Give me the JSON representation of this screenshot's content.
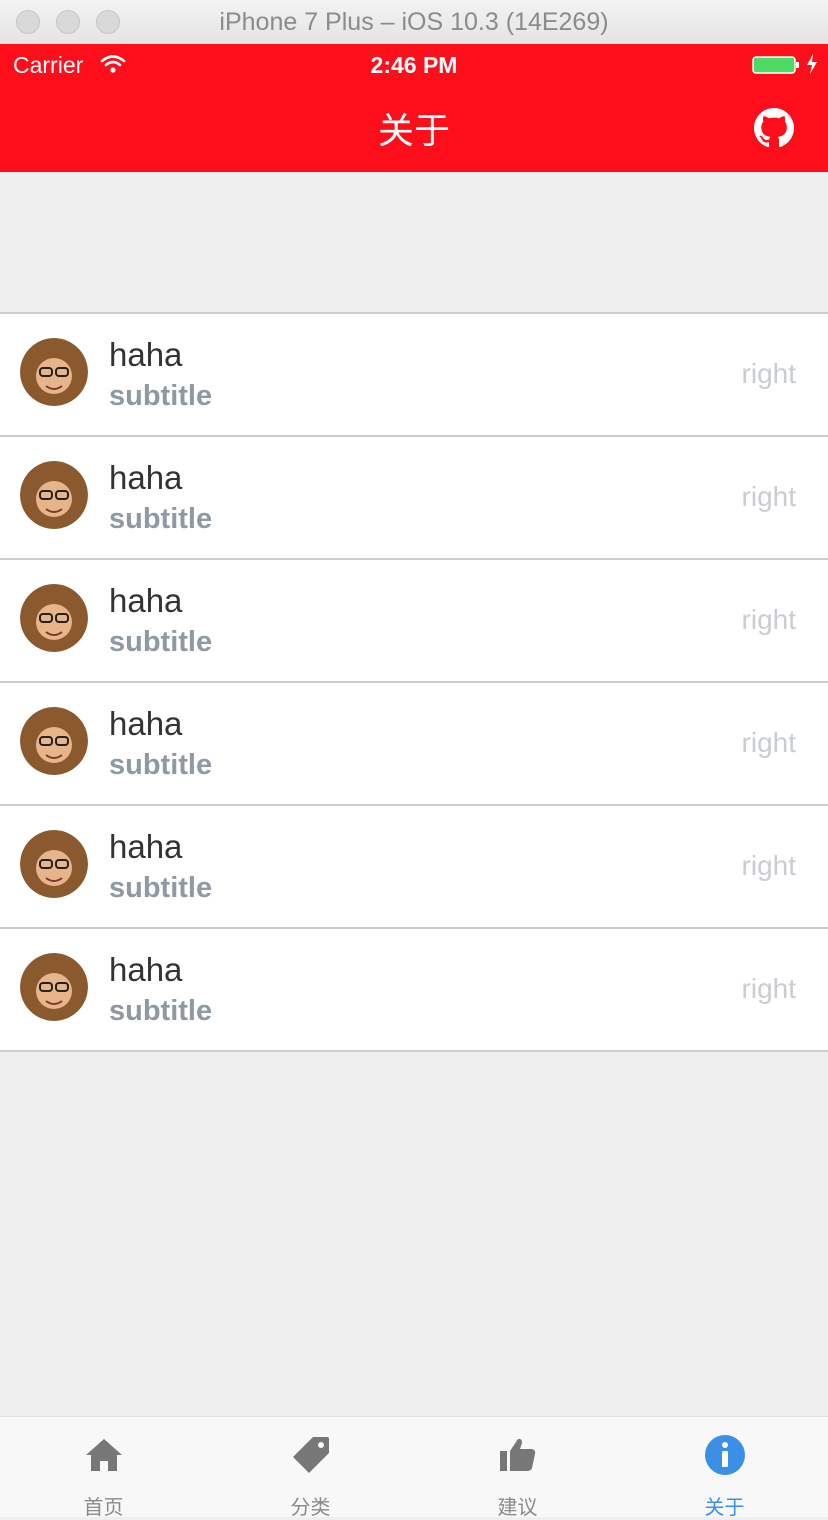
{
  "simulator": {
    "title": "iPhone 7 Plus – iOS 10.3 (14E269)"
  },
  "status_bar": {
    "carrier": "Carrier",
    "time": "2:46 PM"
  },
  "nav": {
    "title": "关于",
    "github_icon": "github-icon"
  },
  "list": {
    "items": [
      {
        "title": "haha",
        "subtitle": "subtitle",
        "right": "right"
      },
      {
        "title": "haha",
        "subtitle": "subtitle",
        "right": "right"
      },
      {
        "title": "haha",
        "subtitle": "subtitle",
        "right": "right"
      },
      {
        "title": "haha",
        "subtitle": "subtitle",
        "right": "right"
      },
      {
        "title": "haha",
        "subtitle": "subtitle",
        "right": "right"
      },
      {
        "title": "haha",
        "subtitle": "subtitle",
        "right": "right"
      }
    ]
  },
  "tabbar": {
    "tabs": [
      {
        "label": "首页",
        "icon": "home-icon"
      },
      {
        "label": "分类",
        "icon": "tag-icon"
      },
      {
        "label": "建议",
        "icon": "thumbs-up-icon"
      },
      {
        "label": "关于",
        "icon": "info-icon",
        "active": true
      }
    ]
  },
  "colors": {
    "header": "#fe0d1a",
    "active_tab": "#3b8fe6",
    "background": "#efefef"
  }
}
